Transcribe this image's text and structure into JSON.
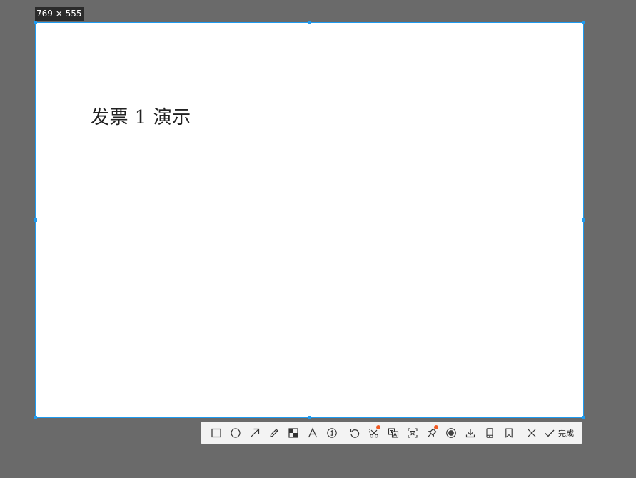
{
  "size_badge": "769 × 555",
  "document": {
    "title": "发票 1 演示"
  },
  "toolbar": {
    "tools": [
      {
        "icon": "rectangle-icon"
      },
      {
        "icon": "ellipse-icon"
      },
      {
        "icon": "arrow-icon"
      },
      {
        "icon": "pencil-icon"
      },
      {
        "icon": "mosaic-icon"
      },
      {
        "icon": "text-icon"
      },
      {
        "icon": "number-marker-icon"
      },
      {
        "icon": "undo-icon"
      },
      {
        "icon": "scissors-icon",
        "badge": true
      },
      {
        "icon": "translate-icon"
      },
      {
        "icon": "ocr-icon"
      },
      {
        "icon": "pin-icon",
        "badge": true
      },
      {
        "icon": "record-icon"
      },
      {
        "icon": "download-icon"
      },
      {
        "icon": "phone-icon"
      },
      {
        "icon": "bookmark-icon"
      },
      {
        "icon": "close-icon"
      }
    ],
    "done_label": "完成"
  },
  "colors": {
    "backdrop": "#6a6a6a",
    "selection_border": "#1e9bf0",
    "badge_dot": "#f05a24"
  }
}
